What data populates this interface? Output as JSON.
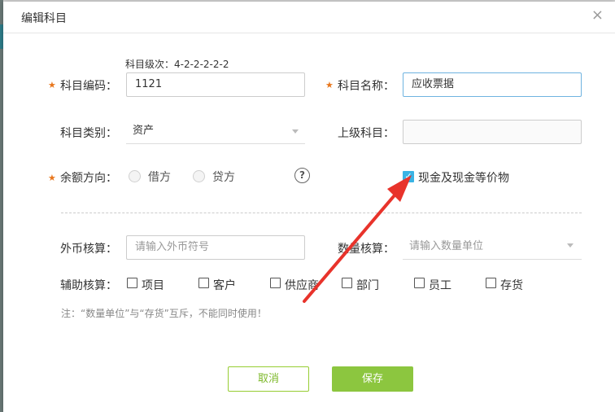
{
  "dialog": {
    "title": "编辑科目",
    "close_symbol": "×"
  },
  "form": {
    "level_hint": "科目级次：4-2-2-2-2-2",
    "required_mark": "★",
    "code": {
      "label": "科目编码：",
      "value": "1121"
    },
    "name": {
      "label": "科目名称：",
      "value": "应收票据"
    },
    "category": {
      "label": "科目类别：",
      "value": "资产"
    },
    "parent": {
      "label": "上级科目：",
      "value": ""
    },
    "balance_direction": {
      "label": "余额方向：",
      "options": [
        "借方",
        "贷方"
      ],
      "help_symbol": "?"
    },
    "cash_equivalent": {
      "label": "现金及现金等价物",
      "checked": true,
      "check_symbol": "✓"
    },
    "foreign_currency": {
      "label": "外币核算：",
      "placeholder": "请输入外币符号"
    },
    "quantity": {
      "label": "数量核算：",
      "placeholder": "请输入数量单位"
    },
    "auxiliary": {
      "label": "辅助核算：",
      "items": [
        "项目",
        "客户",
        "供应商",
        "部门",
        "员工",
        "存货"
      ]
    },
    "note": "注：“数量单位”与“存货”互斥，不能同时使用！"
  },
  "buttons": {
    "cancel": "取消",
    "save": "保存"
  },
  "colors": {
    "accent_green": "#8cc63f",
    "required_orange": "#e8761c",
    "checkbox_blue": "#3ab3e4",
    "annotation_arrow": "#e8332b"
  }
}
